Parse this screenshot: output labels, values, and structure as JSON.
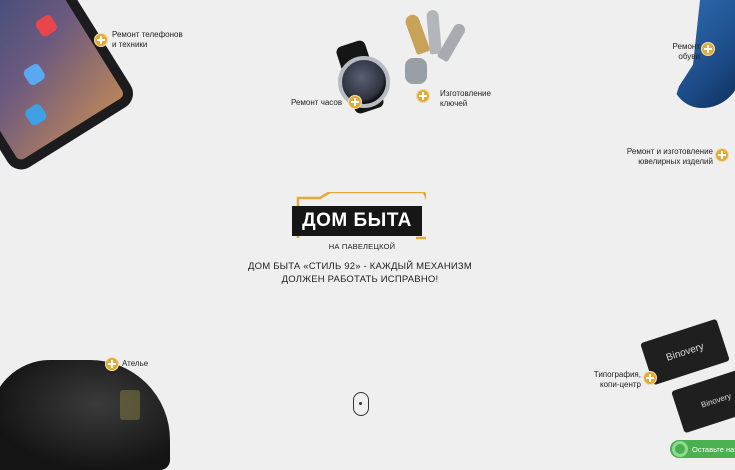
{
  "services": {
    "phones": "Ремонт телефонов\nи техники",
    "watches": "Ремонт часов",
    "keys": "Изготовление\nключей",
    "shoes": "Ремонт\nобуви",
    "jewelry": "Ремонт и изготовление\nювелирных изделий",
    "atelier": "Ателье",
    "printing": "Типография,\nкопи-центр"
  },
  "logo": {
    "title": "ДОМ БЫТА",
    "subtitle": "НА ПАВЕЛЕЦКОЙ"
  },
  "tagline": "ДОМ БЫТА «СТИЛЬ 92» - КАЖДЫЙ МЕХАНИЗМ\nДОЛЖЕН РАБОТАТЬ ИСПРАВНО!",
  "cards": {
    "brand": "Binovery"
  },
  "callback": {
    "label": "Оставьте на"
  },
  "colors": {
    "accent": "#e0ab3a",
    "background": "#efefef",
    "callback": "#4caf50"
  }
}
